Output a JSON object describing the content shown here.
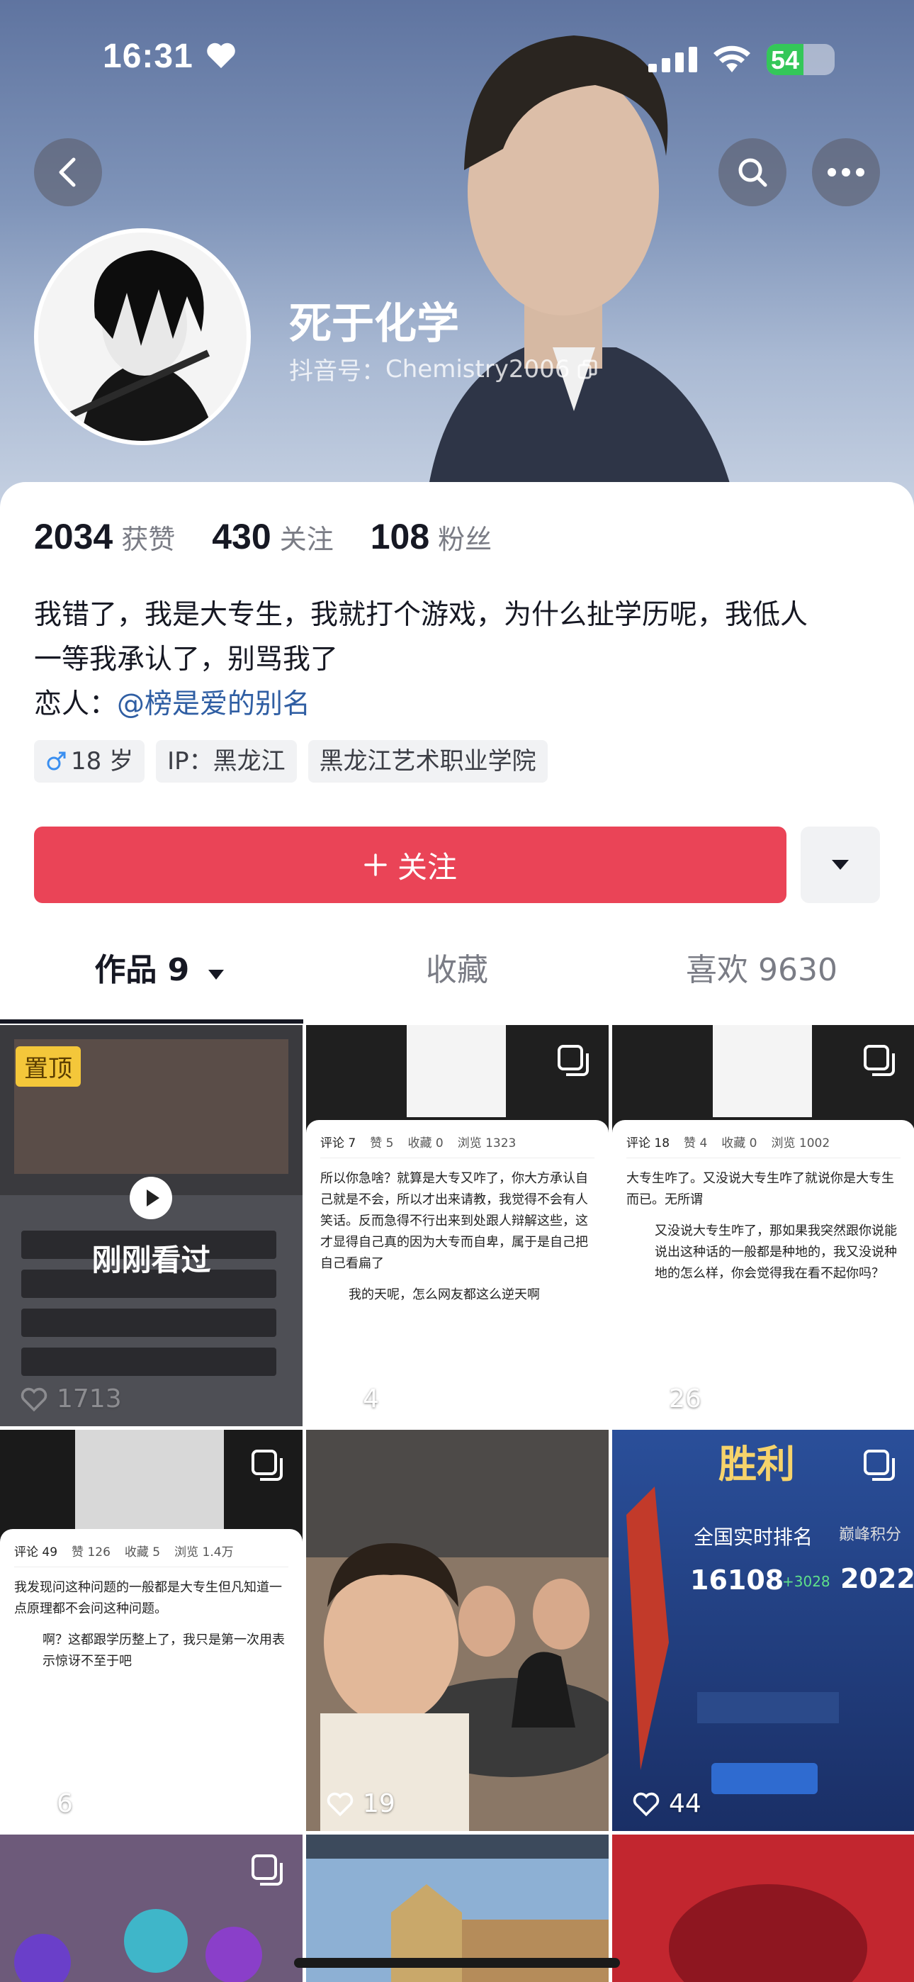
{
  "status_bar": {
    "time": "16:31",
    "battery": "54",
    "battery_level": 0.54
  },
  "profile": {
    "name": "死于化学",
    "douyin_id_label": "抖音号：",
    "douyin_id": "Chemistry2006",
    "stats": [
      {
        "value": "2034",
        "label": "获赞"
      },
      {
        "value": "430",
        "label": "关注"
      },
      {
        "value": "108",
        "label": "粉丝"
      }
    ],
    "bio_line1": "我错了，我是大专生，我就打个游戏，为什么扯学历呢，我低人",
    "bio_line2": "一等我承认了，别骂我了",
    "lover_label": "恋人：",
    "lover_link": "@榜是爱的别名",
    "tags": {
      "age": "18 岁",
      "ip": "IP：黑龙江",
      "school": "黑龙江艺术职业学院"
    }
  },
  "actions": {
    "follow_label": "关注"
  },
  "tabs": [
    {
      "label": "作品 9"
    },
    {
      "label": "收藏"
    },
    {
      "label": "喜欢 9630"
    }
  ],
  "videos": [
    {
      "pinned": "置顶",
      "seen": "刚刚看过",
      "likes": "1713"
    },
    {
      "likes": "4",
      "comment_tab": "评论 7",
      "like_tab": "赞 5",
      "fav_tab": "收藏 0",
      "view_tab": "浏览 1323",
      "text": "所以你急啥？就算是大专又咋了，你大方承认自己就是不会，所以才出来请教，我觉得不会有人笑话。反而急得不行出来到处跟人辩解这些，这才显得自己真的因为大专而自卑，属于是自己把自己看扁了",
      "reply": "我的天呢，怎么网友都这么逆天啊"
    },
    {
      "likes": "26",
      "comment_tab": "评论 18",
      "like_tab": "赞 4",
      "fav_tab": "收藏 0",
      "view_tab": "浏览 1002",
      "text": "大专生咋了。又没说大专生咋了就说你是大专生而已。无所谓",
      "reply": "又没说大专生咋了，那如果我突然跟你说能说出这种话的一般都是种地的，我又没说种地的怎么样，你会觉得我在看不起你吗？"
    },
    {
      "likes": "6",
      "comment_tab": "评论 49",
      "like_tab": "赞 126",
      "fav_tab": "收藏 5",
      "view_tab": "浏览 1.4万",
      "text": "我发现问这种问题的一般都是大专生但凡知道一点原理都不会问这种问题。",
      "reply": "啊？这都跟学历整上了，我只是第一次用表示惊讶不至于吧"
    },
    {
      "likes": "19"
    },
    {
      "likes": "44",
      "game_title": "胜利",
      "rank_label": "全国实时排名",
      "rank_value": "16108",
      "rank_delta": "+3028",
      "score_label": "巅峰积分",
      "score_value": "2022"
    }
  ]
}
